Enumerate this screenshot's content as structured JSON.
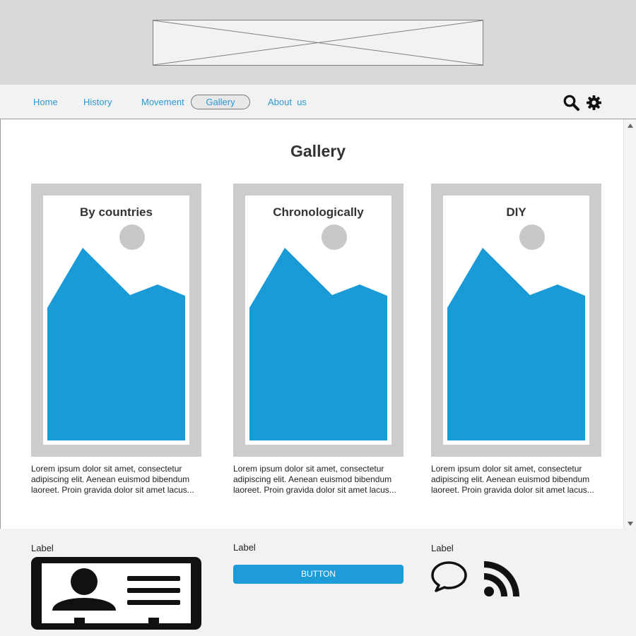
{
  "nav": {
    "items": [
      {
        "label": "Home"
      },
      {
        "label": "History"
      },
      {
        "label": "Movement"
      },
      {
        "label": "Gallery"
      },
      {
        "label": "About  us"
      }
    ],
    "active_index": 3,
    "icons": [
      "search-icon",
      "gear-icon"
    ]
  },
  "main": {
    "title": "Gallery",
    "cards": [
      {
        "title": "By countries",
        "description": "Lorem ipsum dolor sit amet, consectetur adipiscing elit. Aenean euismod bibendum laoreet. Proin gravida dolor sit amet lacus..."
      },
      {
        "title": "Chronologically",
        "description": "Lorem ipsum dolor sit amet, consectetur adipiscing elit. Aenean euismod bibendum laoreet. Proin gravida dolor sit amet lacus..."
      },
      {
        "title": "DIY",
        "description": "Lorem ipsum dolor sit amet, consectetur adipiscing elit. Aenean euismod bibendum laoreet. Proin gravida dolor sit amet lacus..."
      }
    ]
  },
  "footer": {
    "labels": [
      "Label",
      "Label",
      "Label"
    ],
    "button_label": "BUTTON",
    "icons": [
      "contact-card-icon",
      "speech-bubble-icon",
      "rss-icon"
    ]
  },
  "colors": {
    "accent": "#1d9cd8",
    "header_bg": "#d9d9d9",
    "nav_bg": "#f2f2f2",
    "card_frame": "#cccccc"
  }
}
